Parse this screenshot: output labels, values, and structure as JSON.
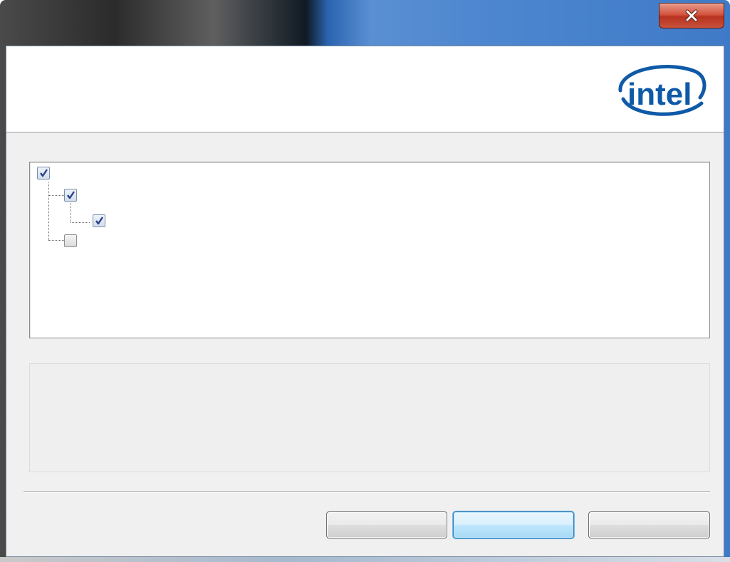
{
  "window": {
    "title": "",
    "close_glyph": "x"
  },
  "header": {
    "logo_text": "intel",
    "logo_color": "#0f5aa8"
  },
  "tree": {
    "nodes": [
      {
        "label": "",
        "checked": true,
        "level": 0
      },
      {
        "label": "",
        "checked": true,
        "level": 1
      },
      {
        "label": "",
        "checked": true,
        "level": 2
      },
      {
        "label": "",
        "checked": false,
        "level": 1
      }
    ]
  },
  "description": {
    "text": ""
  },
  "buttons": {
    "back_label": "",
    "next_label": "",
    "cancel_label": ""
  }
}
